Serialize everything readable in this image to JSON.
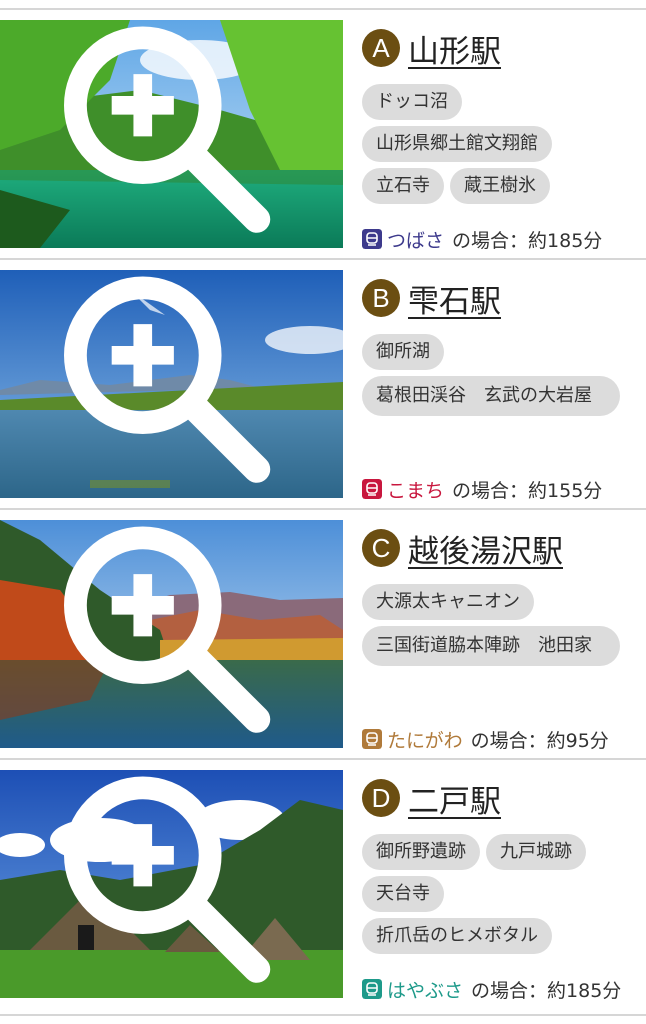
{
  "cards": [
    {
      "badge": "A",
      "station": "山形駅",
      "tags": [
        "ドッコ沼",
        "山形県郷土館文翔館",
        "立石寺",
        "蔵王樹氷"
      ],
      "train": "つばさ",
      "train_color": "#3d3a8c",
      "suffix": "の場合：約185分",
      "photo": "lake-green-forest"
    },
    {
      "badge": "B",
      "station": "雫石駅",
      "tags": [
        "御所湖",
        "葛根田渓谷　玄武の大岩屋"
      ],
      "train": "こまち",
      "train_color": "#c8173e",
      "suffix": "の場合：約155分",
      "photo": "lake-blue-sky"
    },
    {
      "badge": "C",
      "station": "越後湯沢駅",
      "tags": [
        "大源太キャニオン",
        "三国街道脇本陣跡　池田家"
      ],
      "train": "たにがわ",
      "train_color": "#b07a3a",
      "suffix": "の場合：約95分",
      "photo": "lake-autumn"
    },
    {
      "badge": "D",
      "station": "二戸駅",
      "tags": [
        "御所野遺跡",
        "九戸城跡",
        "天台寺",
        "折爪岳のヒメボタル"
      ],
      "train": "はやぶさ",
      "train_color": "#1e9a8a",
      "suffix": "の場合：約185分",
      "photo": "thatched-huts"
    }
  ]
}
